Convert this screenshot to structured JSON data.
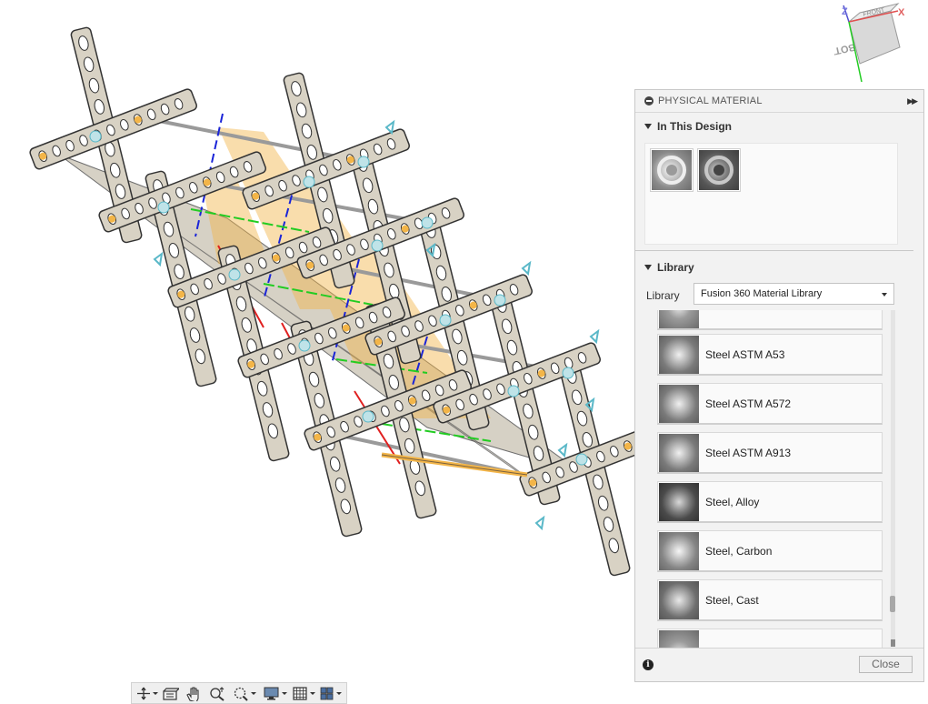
{
  "viewcube": {
    "face_front": "FRONT",
    "face_bottom": "BOTTOM",
    "axis_z": "Z",
    "axis_x": "X"
  },
  "panel": {
    "title": "PHYSICAL MATERIAL",
    "in_design_heading": "In This Design",
    "library_heading": "Library",
    "library_label": "Library",
    "library_selected": "Fusion 360 Material Library",
    "materials": [
      "Steel ASTM A53",
      "Steel ASTM A572",
      "Steel ASTM A913",
      "Steel, Alloy",
      "Steel, Carbon",
      "Steel, Cast"
    ],
    "close_label": "Close",
    "info_glyph": "i"
  },
  "toolbar": {
    "tools": [
      "orbit-icon",
      "look-at-icon",
      "pan-icon",
      "zoom-icon",
      "fit-icon",
      "display-settings-icon",
      "grid-icon",
      "viewports-icon"
    ]
  },
  "colors": {
    "frame_metal": "#d8d2c4",
    "highlight_orange": "#f3b548",
    "rod_gray": "#b8b8b8",
    "axis_blue": "#1a24d8",
    "axis_green": "#22cc22",
    "axis_red": "#e02020",
    "accent_cyan": "#5ab8c8"
  }
}
